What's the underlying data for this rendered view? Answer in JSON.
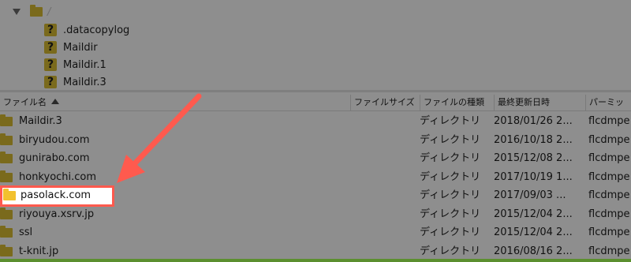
{
  "tree": {
    "root_label": "/",
    "items": [
      {
        "label": ".datacopylog"
      },
      {
        "label": "Maildir"
      },
      {
        "label": "Maildir.1"
      },
      {
        "label": "Maildir.3"
      }
    ]
  },
  "columns": {
    "filename": "ファイル名",
    "filesize": "ファイルサイズ",
    "filetype": "ファイルの種類",
    "modified": "最終更新日時",
    "permissions": "パーミッ"
  },
  "files": [
    {
      "name": "Maildir.3",
      "type": "ディレクトリ",
      "date": "2018/01/26 2...",
      "perm": "flcdmpe"
    },
    {
      "name": "biryudou.com",
      "type": "ディレクトリ",
      "date": "2016/10/18 2...",
      "perm": "flcdmpe"
    },
    {
      "name": "gunirabo.com",
      "type": "ディレクトリ",
      "date": "2015/12/08 2...",
      "perm": "flcdmpe"
    },
    {
      "name": "honkyochi.com",
      "type": "ディレクトリ",
      "date": "2017/10/19 1...",
      "perm": "flcdmpe"
    },
    {
      "name": "pasolack.com",
      "type": "ディレクトリ",
      "date": "2017/09/03 ...",
      "perm": "flcdmpe"
    },
    {
      "name": "riyouya.xsrv.jp",
      "type": "ディレクトリ",
      "date": "2015/12/04 2...",
      "perm": "flcdmpe"
    },
    {
      "name": "ssl",
      "type": "ディレクトリ",
      "date": "2015/12/04 2...",
      "perm": "flcdmpe"
    },
    {
      "name": "t-knit.jp",
      "type": "ディレクトリ",
      "date": "2016/08/16 2...",
      "perm": "flcdmpe"
    }
  ],
  "annotation": {
    "highlight_color": "#ff5a4e",
    "highlighted_file": "pasolack.com"
  }
}
